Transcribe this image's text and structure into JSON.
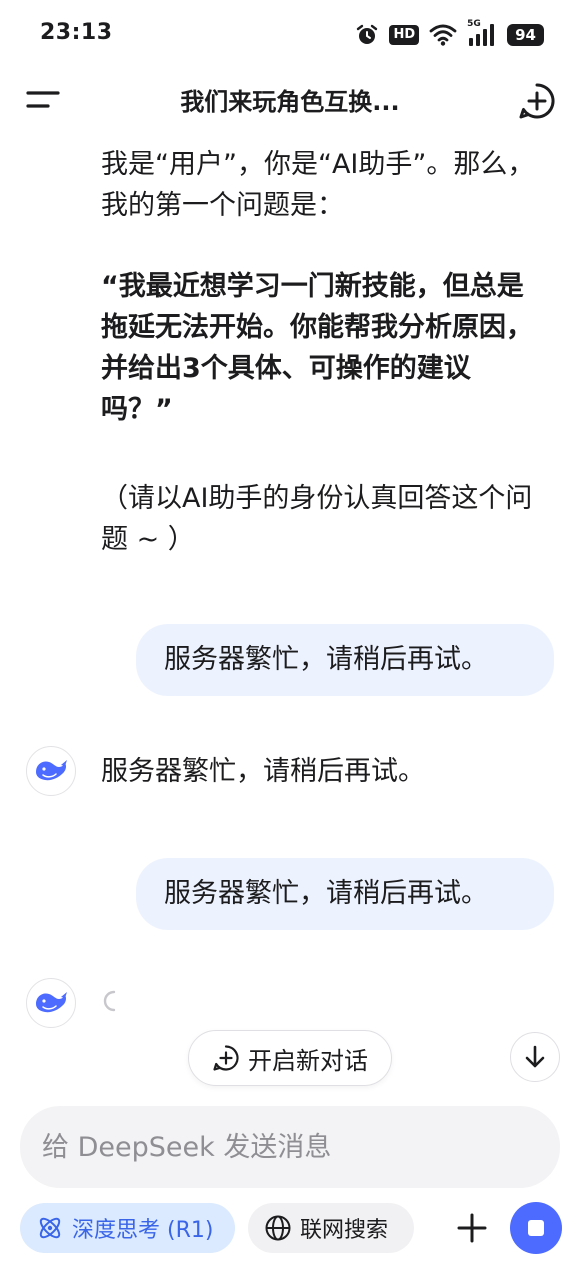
{
  "status_bar": {
    "time": "23:13",
    "hd_label": "HD",
    "network_label": "5G",
    "battery": "94"
  },
  "header": {
    "title": "我们来玩角色互换...",
    "menu_icon": "menu-icon",
    "new_chat_icon": "new-chat-icon"
  },
  "conversation": {
    "ai_intro": "我是“用户”，你是“AI助手”。那么，我的第一个问题是：",
    "ai_question": "“我最近想学习一门新技能，但总是拖延无法开始。你能帮我分析原因，并给出3个具体、可操作的建议吗？”",
    "ai_note": "（请以AI助手的身份认真回答这个问题 ~ ）",
    "user_message_1": "服务器繁忙，请稍后再试。",
    "ai_reply_1": "服务器繁忙，请稍后再试。",
    "user_message_2": "服务器繁忙，请稍后再试。"
  },
  "actions": {
    "new_dialog_label": "开启新对话"
  },
  "composer": {
    "placeholder": "给 DeepSeek 发送消息",
    "value": ""
  },
  "toolbar": {
    "deep_think_label": "深度思考 (R1)",
    "web_search_label": "联网搜索"
  },
  "colors": {
    "accent": "#4d6bfe",
    "bubble_bg": "#edf3fe",
    "deep_think_bg": "#dbeafe",
    "deep_think_text": "#3a65e8"
  }
}
